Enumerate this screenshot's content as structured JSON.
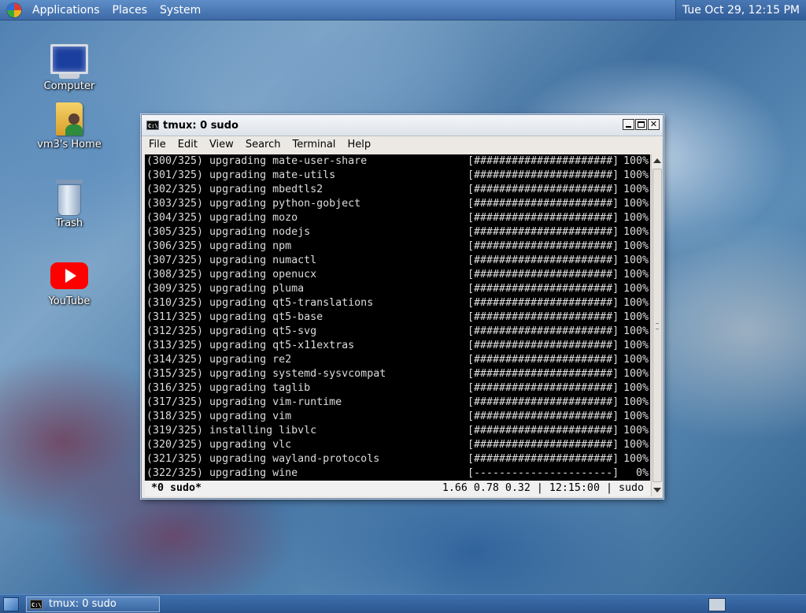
{
  "top_panel": {
    "menus": [
      "Applications",
      "Places",
      "System"
    ],
    "clock": "Tue Oct 29, 12:15 PM"
  },
  "desktop_icons": [
    {
      "label": "Computer",
      "icon": "computer-icon"
    },
    {
      "label": "vm3's Home",
      "icon": "home-folder-icon"
    },
    {
      "label": "Trash",
      "icon": "trash-icon"
    },
    {
      "label": "YouTube",
      "icon": "youtube-icon"
    }
  ],
  "window": {
    "title": "tmux: 0 sudo",
    "menus": [
      "File",
      "Edit",
      "View",
      "Search",
      "Terminal",
      "Help"
    ]
  },
  "terminal": {
    "lines": [
      {
        "text": "(300/325) upgrading mate-user-share",
        "bar": "[######################]",
        "pct": "100%"
      },
      {
        "text": "(301/325) upgrading mate-utils",
        "bar": "[######################]",
        "pct": "100%"
      },
      {
        "text": "(302/325) upgrading mbedtls2",
        "bar": "[######################]",
        "pct": "100%"
      },
      {
        "text": "(303/325) upgrading python-gobject",
        "bar": "[######################]",
        "pct": "100%"
      },
      {
        "text": "(304/325) upgrading mozo",
        "bar": "[######################]",
        "pct": "100%"
      },
      {
        "text": "(305/325) upgrading nodejs",
        "bar": "[######################]",
        "pct": "100%"
      },
      {
        "text": "(306/325) upgrading npm",
        "bar": "[######################]",
        "pct": "100%"
      },
      {
        "text": "(307/325) upgrading numactl",
        "bar": "[######################]",
        "pct": "100%"
      },
      {
        "text": "(308/325) upgrading openucx",
        "bar": "[######################]",
        "pct": "100%"
      },
      {
        "text": "(309/325) upgrading pluma",
        "bar": "[######################]",
        "pct": "100%"
      },
      {
        "text": "(310/325) upgrading qt5-translations",
        "bar": "[######################]",
        "pct": "100%"
      },
      {
        "text": "(311/325) upgrading qt5-base",
        "bar": "[######################]",
        "pct": "100%"
      },
      {
        "text": "(312/325) upgrading qt5-svg",
        "bar": "[######################]",
        "pct": "100%"
      },
      {
        "text": "(313/325) upgrading qt5-x11extras",
        "bar": "[######################]",
        "pct": "100%"
      },
      {
        "text": "(314/325) upgrading re2",
        "bar": "[######################]",
        "pct": "100%"
      },
      {
        "text": "(315/325) upgrading systemd-sysvcompat",
        "bar": "[######################]",
        "pct": "100%"
      },
      {
        "text": "(316/325) upgrading taglib",
        "bar": "[######################]",
        "pct": "100%"
      },
      {
        "text": "(317/325) upgrading vim-runtime",
        "bar": "[######################]",
        "pct": "100%"
      },
      {
        "text": "(318/325) upgrading vim",
        "bar": "[######################]",
        "pct": "100%"
      },
      {
        "text": "(319/325) installing libvlc",
        "bar": "[######################]",
        "pct": "100%"
      },
      {
        "text": "(320/325) upgrading vlc",
        "bar": "[######################]",
        "pct": "100%"
      },
      {
        "text": "(321/325) upgrading wayland-protocols",
        "bar": "[######################]",
        "pct": "100%"
      },
      {
        "text": "(322/325) upgrading wine",
        "bar": "[----------------------]",
        "pct": "0%"
      }
    ],
    "status_left": "*0 sudo*",
    "status_right": "1.66 0.78 0.32 | 12:15:00 | sudo"
  },
  "taskbar": {
    "task_label": "tmux: 0 sudo"
  }
}
